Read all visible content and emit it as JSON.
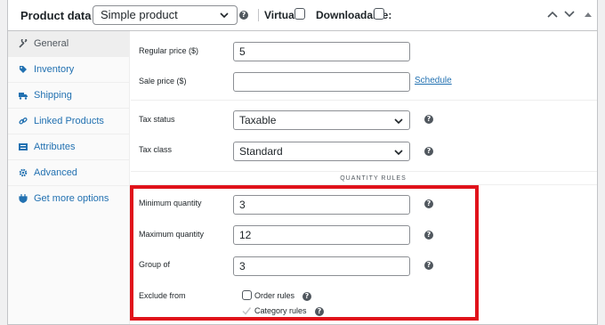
{
  "header": {
    "title": "Product data —",
    "product_type": "Simple product",
    "virtual_label": "Virtual:",
    "downloadable_label": "Downloadable:"
  },
  "sidebar": {
    "tabs": [
      {
        "label": "General",
        "icon": "wrench-icon",
        "active": true
      },
      {
        "label": "Inventory",
        "icon": "tag-icon",
        "active": false
      },
      {
        "label": "Shipping",
        "icon": "truck-icon",
        "active": false
      },
      {
        "label": "Linked Products",
        "icon": "link-icon",
        "active": false
      },
      {
        "label": "Attributes",
        "icon": "list-icon",
        "active": false
      },
      {
        "label": "Advanced",
        "icon": "gear-icon",
        "active": false
      },
      {
        "label": "Get more options",
        "icon": "plugin-icon",
        "active": false
      }
    ]
  },
  "general": {
    "regular_price_label": "Regular price ($)",
    "regular_price_value": "5",
    "sale_price_label": "Sale price ($)",
    "sale_price_value": "",
    "schedule_link": "Schedule",
    "tax_status_label": "Tax status",
    "tax_status_value": "Taxable",
    "tax_class_label": "Tax class",
    "tax_class_value": "Standard"
  },
  "quantity_rules": {
    "heading": "QUANTITY RULES",
    "min_label": "Minimum quantity",
    "min_value": "3",
    "max_label": "Maximum quantity",
    "max_value": "12",
    "group_label": "Group of",
    "group_value": "3",
    "exclude_label": "Exclude from",
    "order_rules_label": "Order rules",
    "category_rules_label": "Category rules"
  },
  "colors": {
    "accent": "#2271b1",
    "highlight": "#e0131b"
  }
}
